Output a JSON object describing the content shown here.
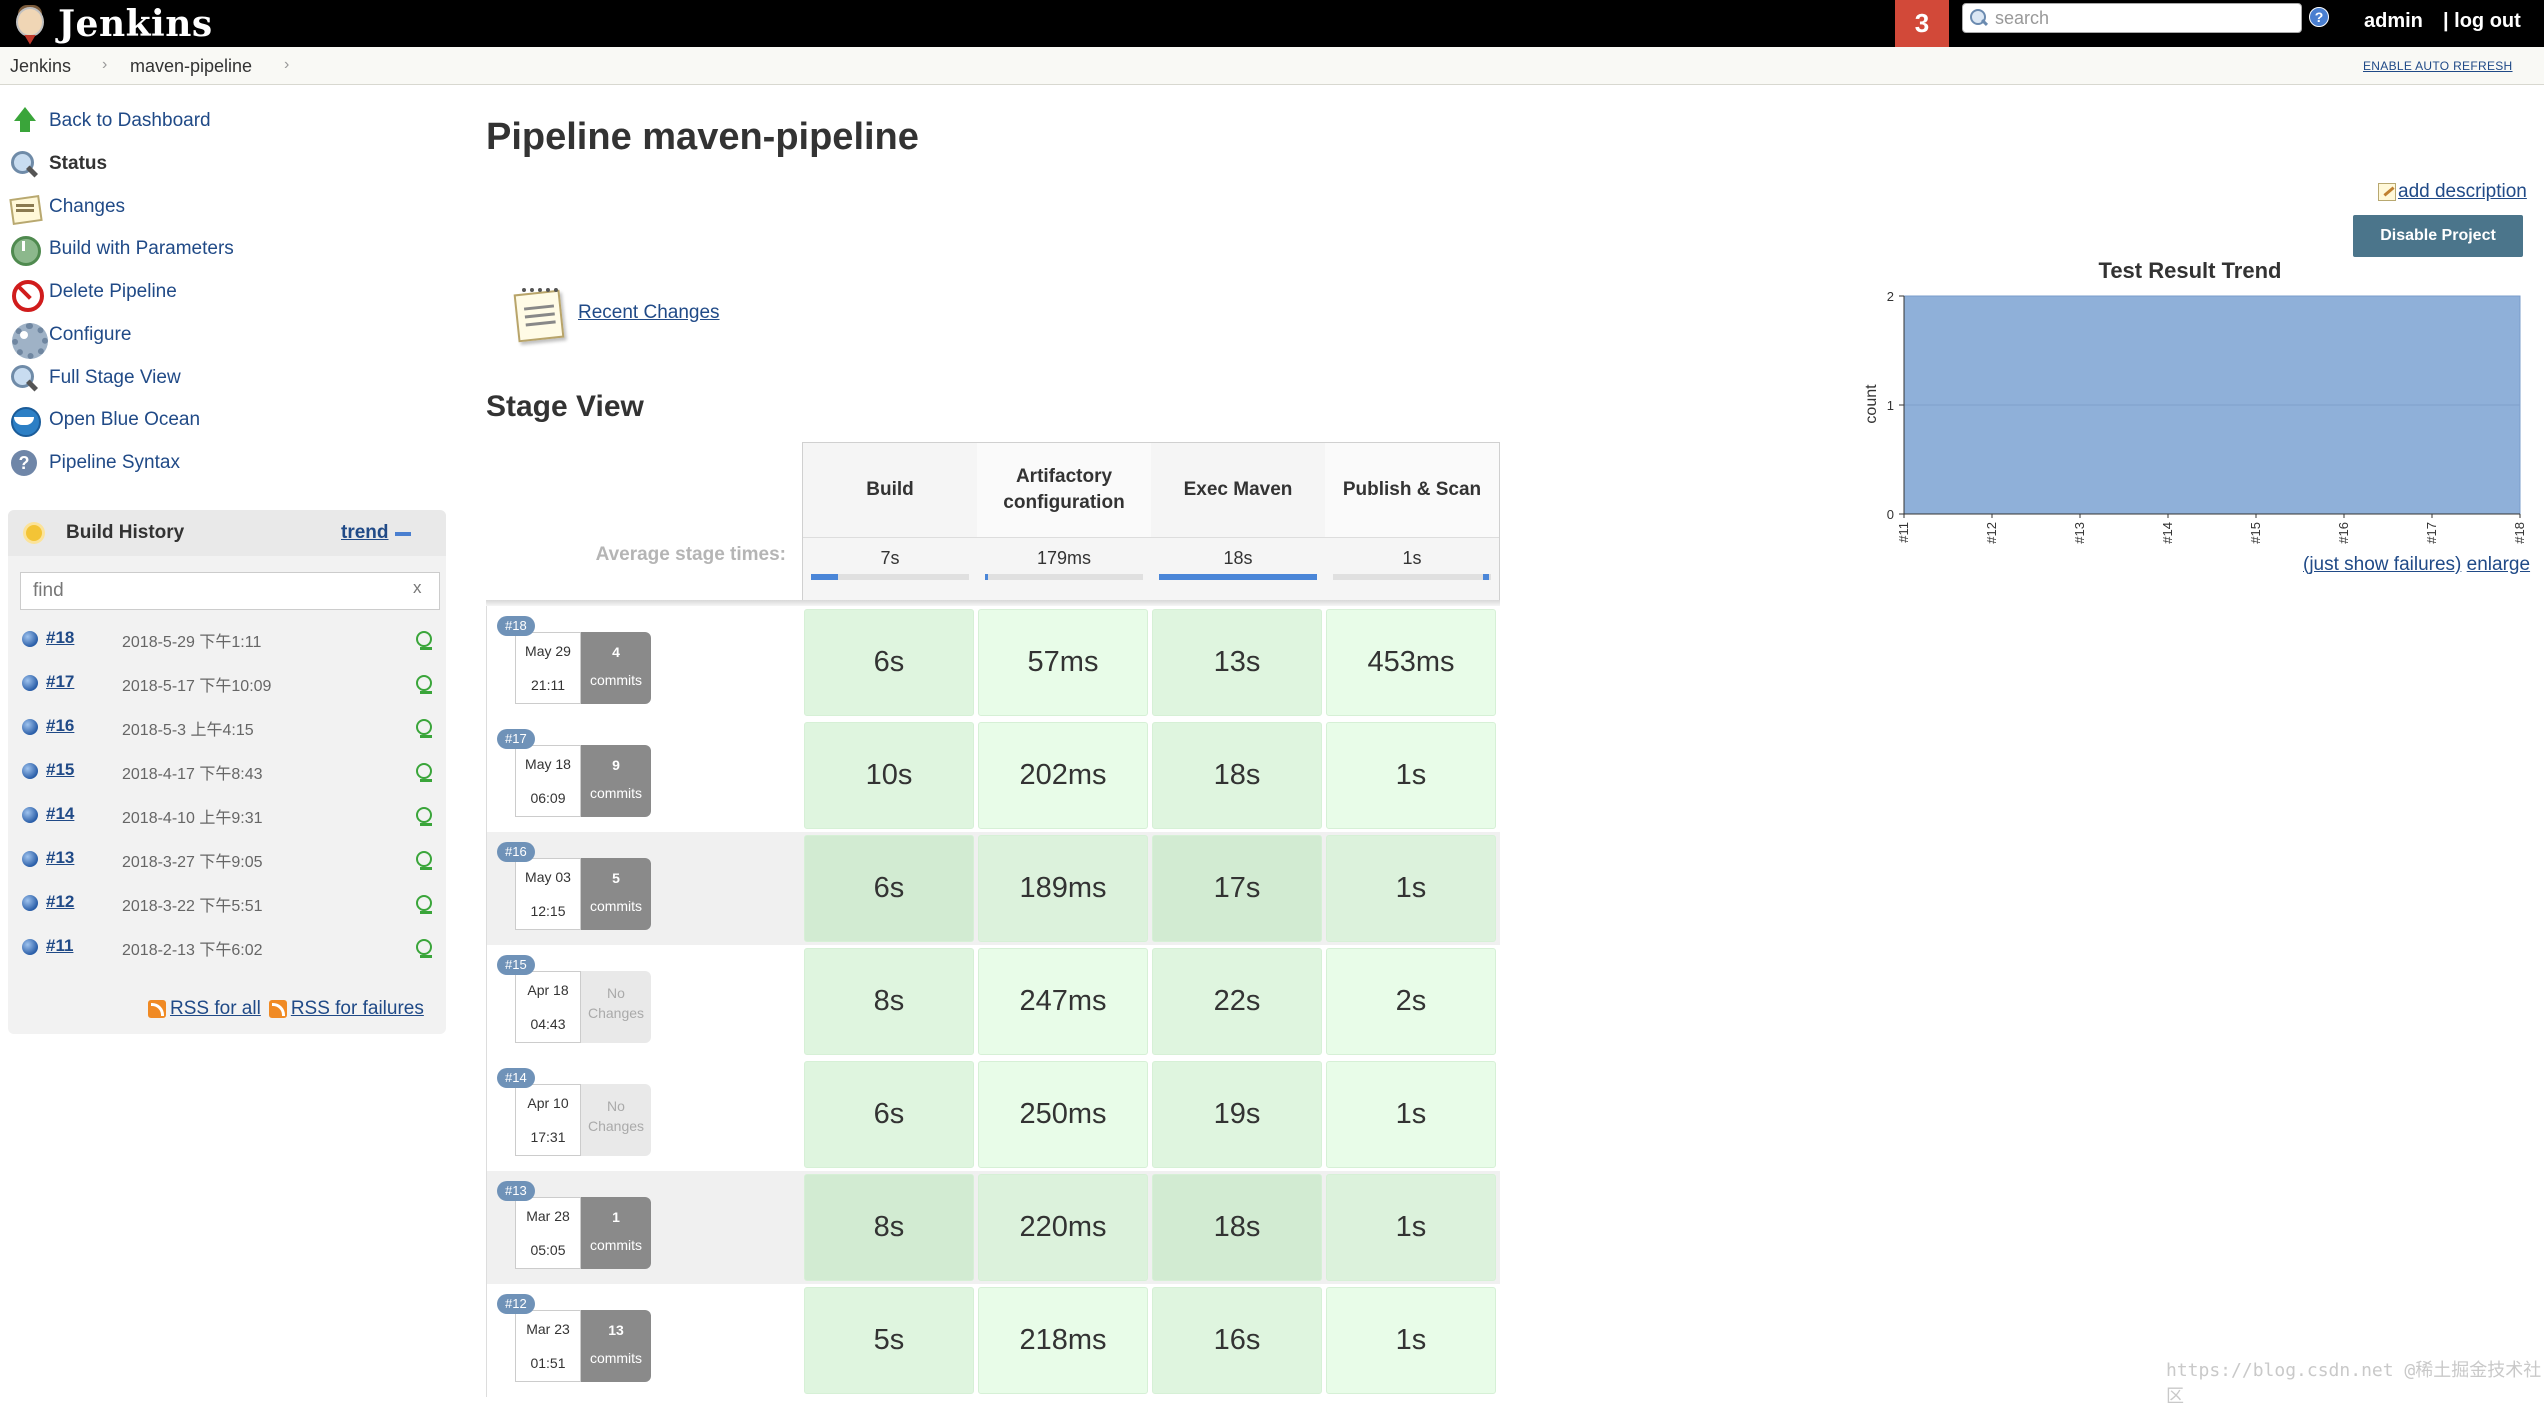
{
  "header": {
    "brand": "Jenkins",
    "notification_count": "3",
    "search_placeholder": "search",
    "user": "admin",
    "logout": "log out"
  },
  "breadcrumbs": [
    "Jenkins",
    "maven-pipeline"
  ],
  "breadcrumb_sep": "›",
  "auto_refresh": "ENABLE AUTO REFRESH",
  "tasks": [
    {
      "label": "Back to Dashboard",
      "icon": "up-arrow-icon"
    },
    {
      "label": "Status",
      "icon": "magnifier-icon"
    },
    {
      "label": "Changes",
      "icon": "notepad-icon"
    },
    {
      "label": "Build with Parameters",
      "icon": "clock-icon"
    },
    {
      "label": "Delete Pipeline",
      "icon": "delete-icon"
    },
    {
      "label": "Configure",
      "icon": "gear-icon"
    },
    {
      "label": "Full Stage View",
      "icon": "magnifier-icon"
    },
    {
      "label": "Open Blue Ocean",
      "icon": "blue-ocean-icon"
    },
    {
      "label": "Pipeline Syntax",
      "icon": "help-icon"
    }
  ],
  "build_history": {
    "title": "Build History",
    "trend": "trend",
    "filter_placeholder": "find",
    "clear": "x",
    "builds": [
      {
        "num": "#18",
        "date": "2018-5-29 下午1:11"
      },
      {
        "num": "#17",
        "date": "2018-5-17 下午10:09"
      },
      {
        "num": "#16",
        "date": "2018-5-3 上午4:15"
      },
      {
        "num": "#15",
        "date": "2018-4-17 下午8:43"
      },
      {
        "num": "#14",
        "date": "2018-4-10 上午9:31"
      },
      {
        "num": "#13",
        "date": "2018-3-27 下午9:05"
      },
      {
        "num": "#12",
        "date": "2018-3-22 下午5:51"
      },
      {
        "num": "#11",
        "date": "2018-2-13 下午6:02"
      }
    ],
    "rss_all": "RSS for all",
    "rss_failures": "RSS for failures"
  },
  "main": {
    "title": "Pipeline maven-pipeline",
    "add_description": "add description",
    "disable_button": "Disable Project",
    "recent_changes": "Recent Changes",
    "stage_view_title": "Stage View",
    "avg_label": "Average stage times:"
  },
  "stages": [
    {
      "name": "Build",
      "avg": "7s",
      "avg_fraction": 0.17
    },
    {
      "name": "Artifactory configuration",
      "avg": "179ms",
      "avg_fraction": 0.005
    },
    {
      "name": "Exec Maven",
      "avg": "18s",
      "avg_fraction": 1.0
    },
    {
      "name": "Publish & Scan",
      "avg": "1s",
      "avg_fraction": 0.05
    }
  ],
  "stage_builds": [
    {
      "num": "#18",
      "month_day": "May 29",
      "time": "21:11",
      "commits": "4",
      "commits_label": "commits",
      "durations": [
        "6s",
        "57ms",
        "13s",
        "453ms"
      ]
    },
    {
      "num": "#17",
      "month_day": "May 18",
      "time": "06:09",
      "commits": "9",
      "commits_label": "commits",
      "durations": [
        "10s",
        "202ms",
        "18s",
        "1s"
      ]
    },
    {
      "num": "#16",
      "month_day": "May 03",
      "time": "12:15",
      "commits": "5",
      "commits_label": "commits",
      "durations": [
        "6s",
        "189ms",
        "17s",
        "1s"
      ]
    },
    {
      "num": "#15",
      "month_day": "Apr 18",
      "time": "04:43",
      "commits": "No",
      "commits_label": "Changes",
      "durations": [
        "8s",
        "247ms",
        "22s",
        "2s"
      ]
    },
    {
      "num": "#14",
      "month_day": "Apr 10",
      "time": "17:31",
      "commits": "No",
      "commits_label": "Changes",
      "durations": [
        "6s",
        "250ms",
        "19s",
        "1s"
      ]
    },
    {
      "num": "#13",
      "month_day": "Mar 28",
      "time": "05:05",
      "commits": "1",
      "commits_label": "commits",
      "durations": [
        "8s",
        "220ms",
        "18s",
        "1s"
      ]
    },
    {
      "num": "#12",
      "month_day": "Mar 23",
      "time": "01:51",
      "commits": "13",
      "commits_label": "commits",
      "durations": [
        "5s",
        "218ms",
        "16s",
        "1s"
      ]
    }
  ],
  "chart_data": {
    "type": "area",
    "title": "Test Result Trend",
    "ylabel": "count",
    "categories": [
      "#11",
      "#12",
      "#13",
      "#14",
      "#15",
      "#16",
      "#17",
      "#18"
    ],
    "series": [
      {
        "values": [
          2,
          2,
          2,
          2,
          2,
          2,
          2,
          2
        ]
      }
    ],
    "ylim": [
      0,
      2
    ],
    "yticks": [
      "0",
      "1",
      "2"
    ],
    "color": "#8fb0d9",
    "links": [
      "(just show failures)",
      "enlarge"
    ]
  },
  "watermark": "https://blog.csdn.net @稀土掘金技术社区"
}
